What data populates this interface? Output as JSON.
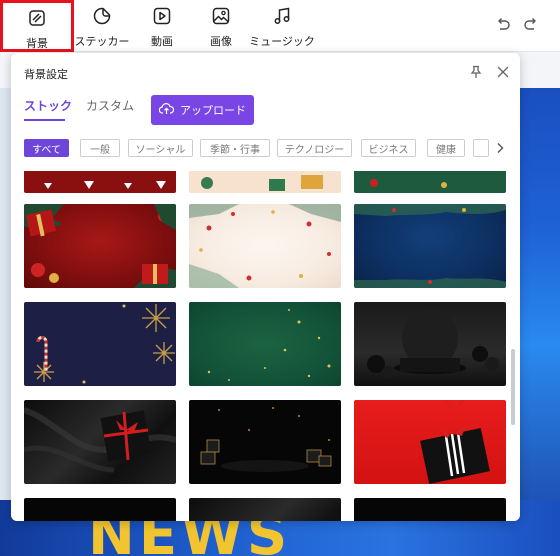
{
  "toolbar": {
    "items": [
      {
        "label": "背景",
        "icon": "background-icon"
      },
      {
        "label": "ステッカー",
        "icon": "sticker-icon"
      },
      {
        "label": "動画",
        "icon": "video-icon"
      },
      {
        "label": "画像",
        "icon": "image-icon"
      },
      {
        "label": "ミュージック",
        "icon": "music-icon"
      }
    ],
    "selected": "背景",
    "highlight_color": "#e8121e"
  },
  "background_text": "NEWS",
  "panel": {
    "title": "背景設定",
    "tabs": [
      "ストック",
      "カスタム"
    ],
    "active_tab": "ストック",
    "upload_label": "アップロード",
    "accent_color": "#7a45e5",
    "categories": [
      "すべて",
      "一般",
      "ソーシャル",
      "季節・行事",
      "テクノロジー",
      "ビジネス",
      "健康"
    ],
    "active_category": "すべて",
    "thumbnails": [
      "Christmas red ribbon border",
      "Christmas cream gifts border",
      "Christmas green pine border",
      "Christmas red gifts with ornaments",
      "Christmas cream with snowflakes",
      "Christmas navy with pine frame",
      "Navy with gold snowflakes and candy canes",
      "Green with gold sparkles",
      "Black stage with balloons",
      "Black silk with gift box",
      "Dark night with gift boxes",
      "Red background with black gift box"
    ]
  }
}
